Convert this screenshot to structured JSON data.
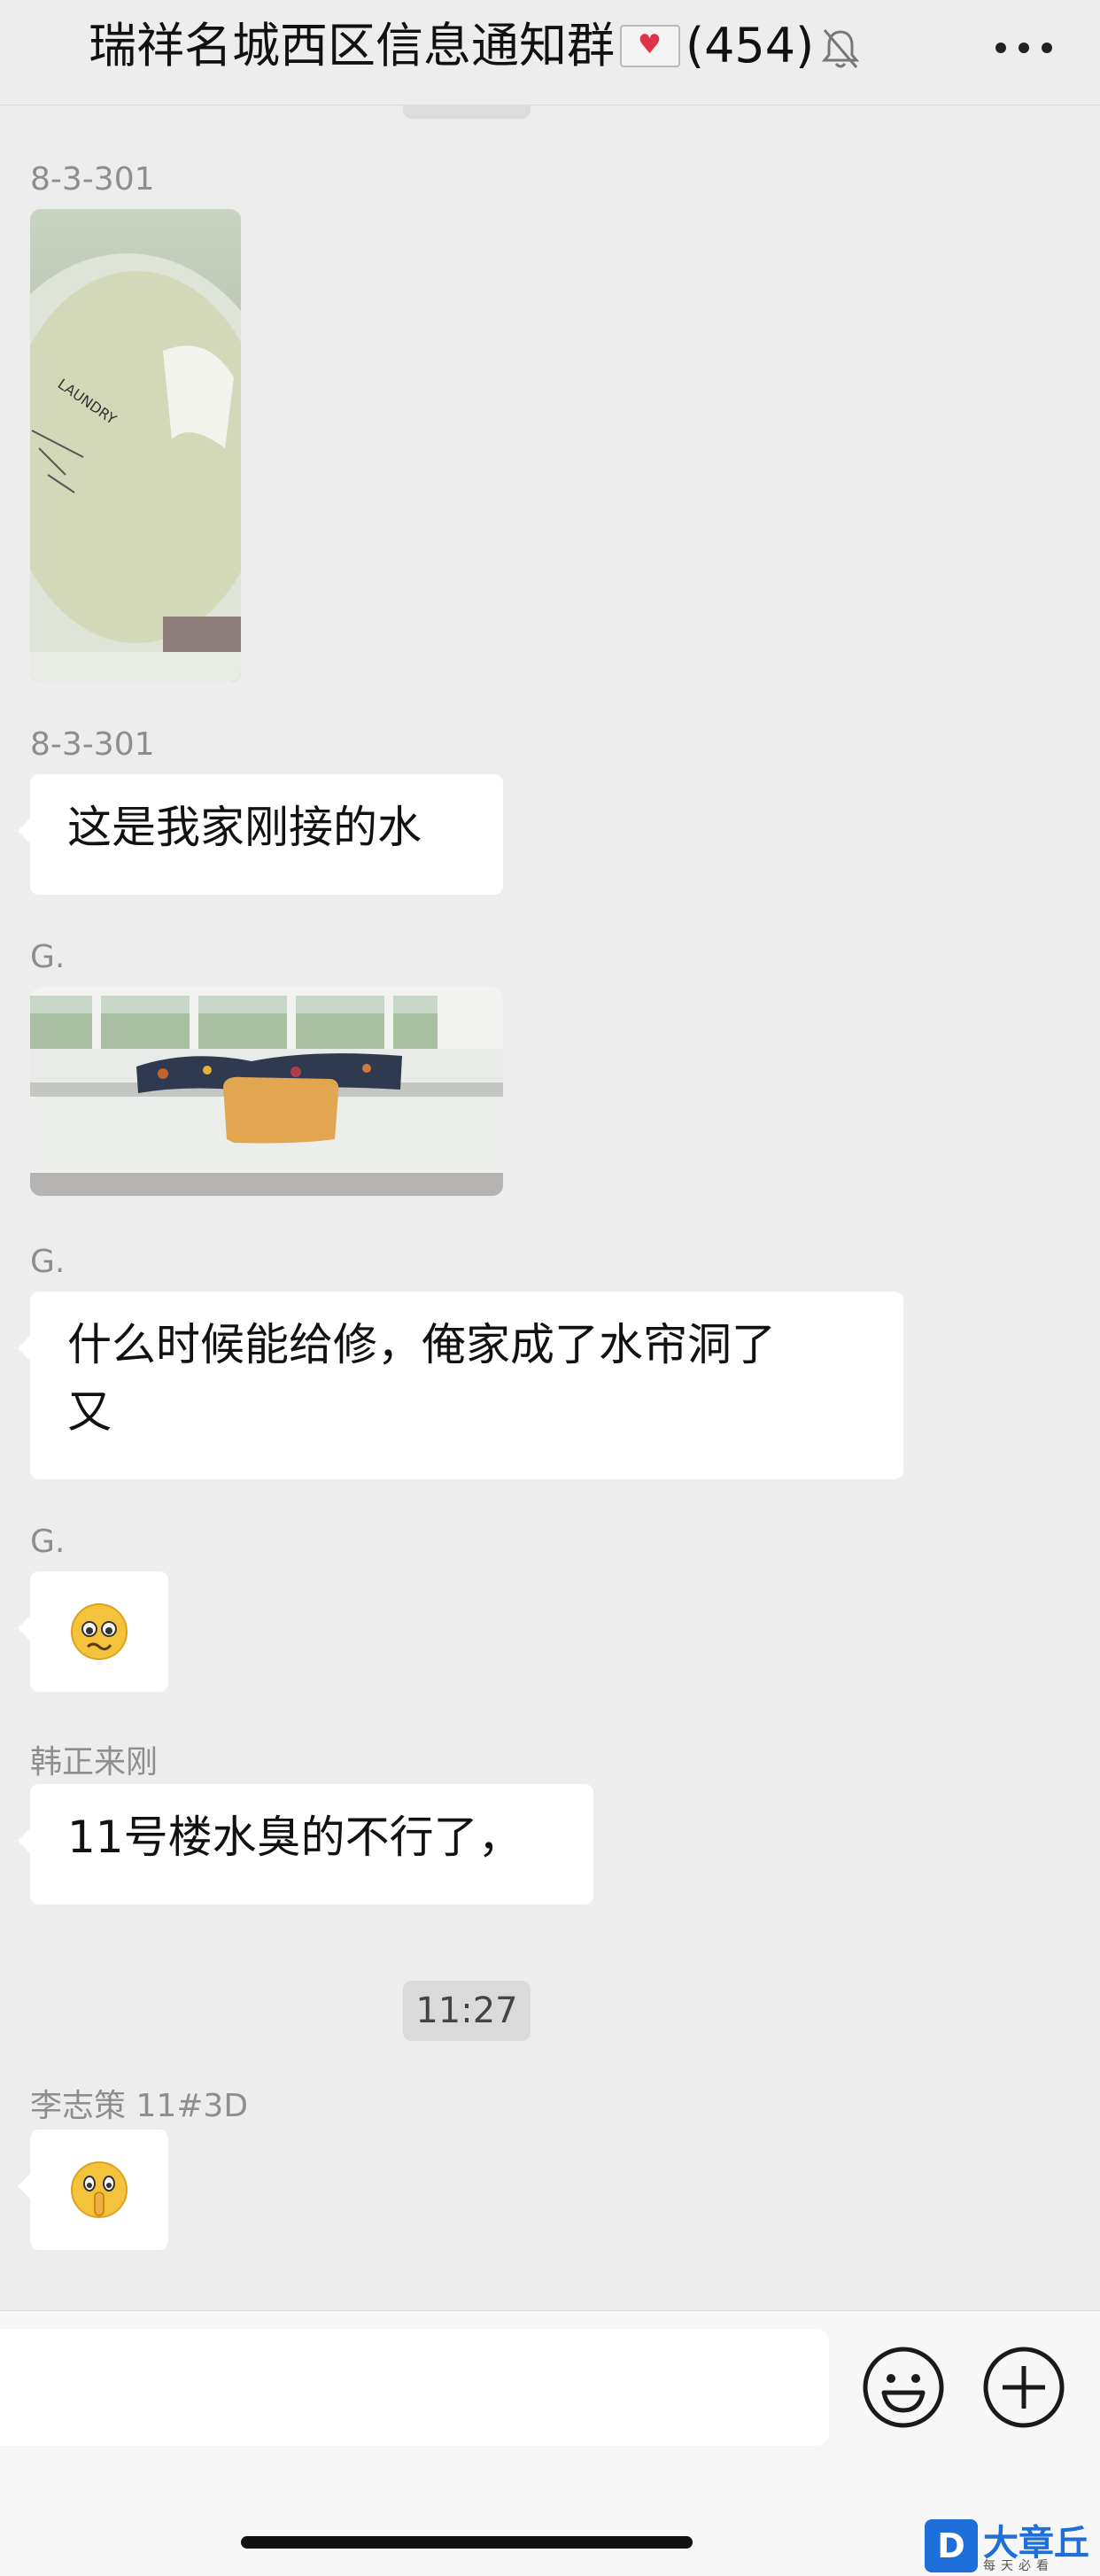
{
  "header": {
    "group_name": "瑞祥名城西区信息通知群",
    "member_count": "(454)"
  },
  "messages": [
    {
      "sender": "8-3-301",
      "type": "image"
    },
    {
      "sender": "8-3-301",
      "type": "text",
      "text": "这是我家刚接的水"
    },
    {
      "sender": "G.",
      "type": "image"
    },
    {
      "sender": "G.",
      "type": "text",
      "line1": "什么时候能给修，俺家成了水帘洞了",
      "line2": "又"
    },
    {
      "sender": "G.",
      "type": "emoji",
      "emoji": "😟"
    },
    {
      "sender": "韩正来刚",
      "type": "text",
      "text": "11号楼水臭的不行了，"
    },
    {
      "sender": "李志策 11#3D",
      "type": "emoji",
      "emoji": "🤫"
    }
  ],
  "time_divider": "11:27",
  "watermark": {
    "logo": "D",
    "name": "大章丘",
    "sub": "每天必看"
  },
  "colors": {
    "background": "#ededed",
    "bubble": "#ffffff",
    "watermark": "#1e6fd9"
  },
  "icons": [
    "envelope-heart-icon",
    "mute-bell-icon",
    "more-icon",
    "emoji-icon",
    "plus-icon"
  ]
}
